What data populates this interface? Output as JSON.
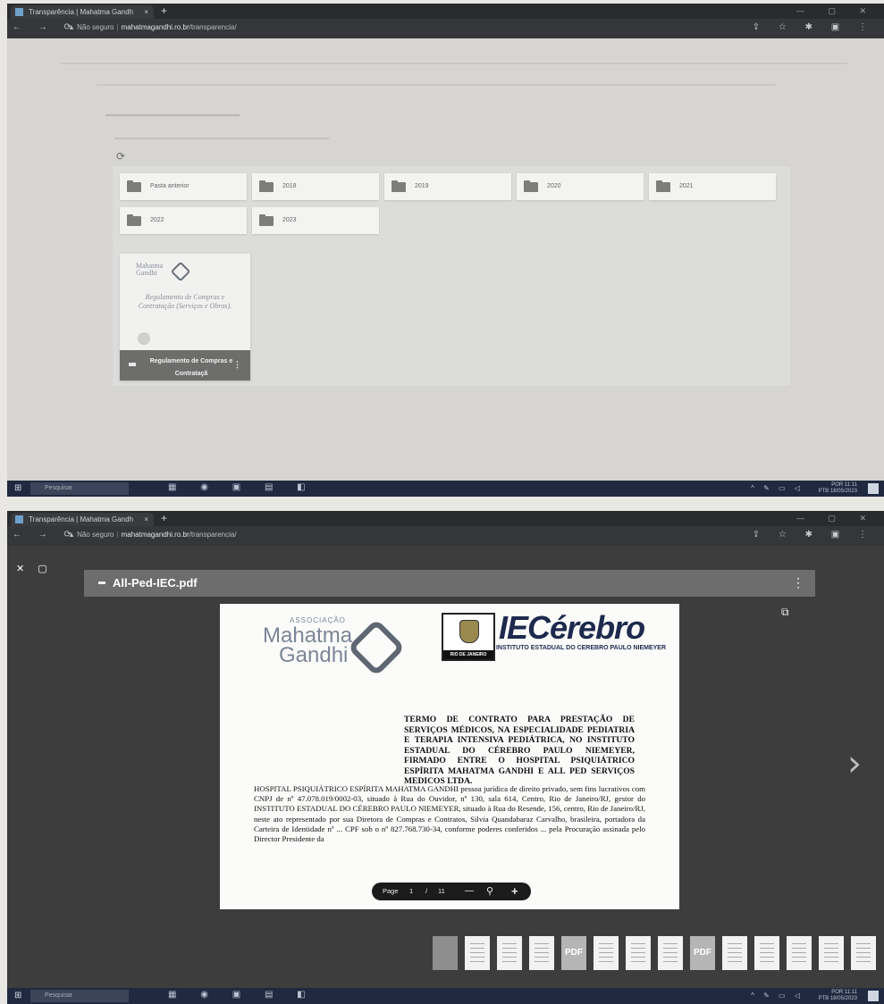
{
  "browser": {
    "tab_title": "Transparência | Mahatma Gandh",
    "tab_close": "×",
    "new_tab": "+",
    "url_security": "Não seguro",
    "url_domain": "mahatmagandhi.ro.br",
    "url_path": "/transparencia/"
  },
  "screen1": {
    "folders": [
      {
        "label": "Pasta anterior"
      },
      {
        "label": "2018"
      },
      {
        "label": "2019"
      },
      {
        "label": "2020"
      },
      {
        "label": "2021"
      },
      {
        "label": "2022"
      },
      {
        "label": "2023"
      }
    ],
    "doc_card": {
      "logo_text": "Mahatma\nGandhi",
      "cover_title": "Regulamento de Compras e Contratação (Serviços e Obras).",
      "caption": "Regulamento de Compras e Contrataçã"
    }
  },
  "screen2": {
    "file_name": "All-Ped-IEC.pdf",
    "page_label": "Page",
    "page_current": "1",
    "page_sep": "/",
    "page_total": "11",
    "zoom_out": "—",
    "zoom_in": "+",
    "logo_assoc": "ASSOCIAÇÃO",
    "logo_mahatma": "Mahatma",
    "logo_gandhi": "Gandhi",
    "rj_label": "RIO DE JANEIRO",
    "iec_title": "IECérebro",
    "iec_subtitle": "INSTITUTO ESTADUAL DO CEREBRO PAULO NIEMEYER",
    "contract_title": "TERMO DE CONTRATO PARA PRESTAÇÃO DE SERVIÇOS MÉDICOS, NA ESPECIALIDADE PEDIATRIA E TERAPIA INTENSIVA PEDIÁTRICA, NO INSTITUTO ESTADUAL DO CÉREBRO PAULO NIEMEYER, FIRMADO ENTRE O HOSPITAL PSIQUIÁTRICO ESPÍRITA MAHATMA GANDHI E ALL PED SERVIÇOS MEDICOS LTDA.",
    "contract_body": "HOSPITAL PSIQUIÁTRICO ESPÍRITA MAHATMA GANDHI pessoa jurídica de direito privado, sem fins lucrativos com CNPJ de nº 47.078.019/0002-03, situado à Rua do Ouvidor, nº 130, sala 614, Centro, Rio de Janeiro/RJ, gestor do INSTITUTO ESTADUAL DO CÉREBRO PAULO NIEMEYER, situado à Rua do Resende, 156, centro, Rio de Janeiro/RJ, neste ato representado por sua Diretora de Compras e Contratos, Silvia Quandabaraz Carvalho, brasileira, portadora da Carteira de Identidade nº ... CPF sob o nº 827.768.730-34, conforme poderes conferidos ... pela Procuração assinada pelo Director Presidente da",
    "thumbnails": [
      {
        "kind": "dim"
      },
      {
        "kind": "page"
      },
      {
        "kind": "page"
      },
      {
        "kind": "page"
      },
      {
        "kind": "pdf",
        "label": "PDF"
      },
      {
        "kind": "page"
      },
      {
        "kind": "page"
      },
      {
        "kind": "page"
      },
      {
        "kind": "pdf",
        "label": "PDF"
      },
      {
        "kind": "page"
      },
      {
        "kind": "page"
      },
      {
        "kind": "page"
      },
      {
        "kind": "page"
      },
      {
        "kind": "page"
      }
    ]
  },
  "taskbar": {
    "search_placeholder": "Pesquisar",
    "lang": "POR",
    "lang2": "PTB",
    "time": "11:11",
    "date": "18/05/2023"
  }
}
